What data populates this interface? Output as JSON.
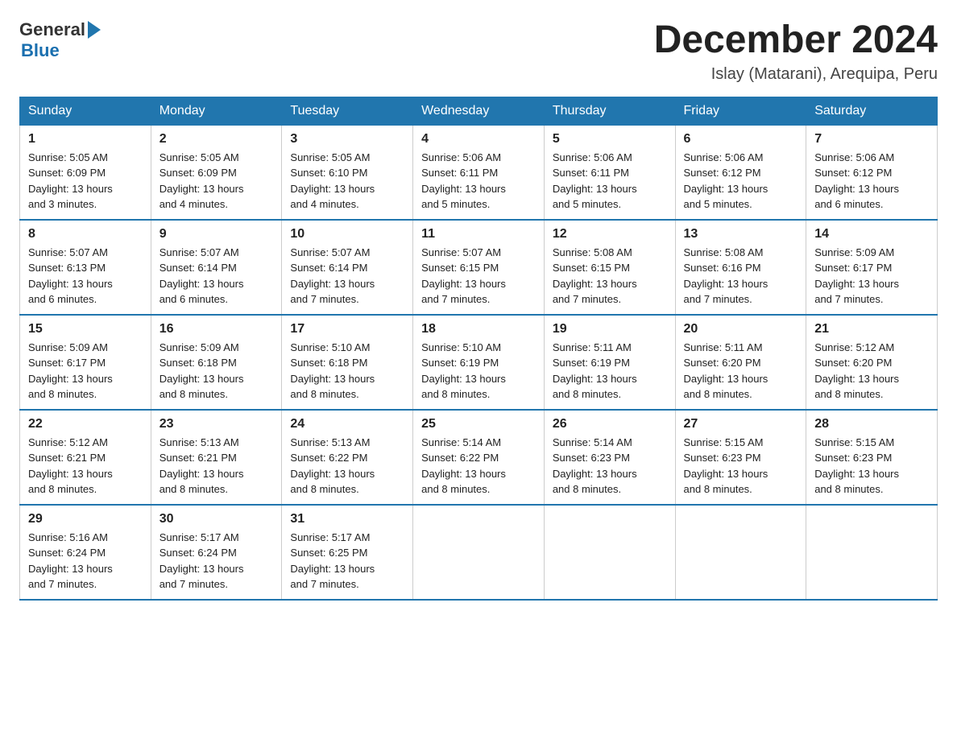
{
  "header": {
    "logo": {
      "general": "General",
      "blue": "Blue",
      "arrow": true
    },
    "title": "December 2024",
    "location": "Islay (Matarani), Arequipa, Peru"
  },
  "calendar": {
    "days_of_week": [
      "Sunday",
      "Monday",
      "Tuesday",
      "Wednesday",
      "Thursday",
      "Friday",
      "Saturday"
    ],
    "weeks": [
      [
        {
          "day": "1",
          "sunrise": "5:05 AM",
          "sunset": "6:09 PM",
          "daylight": "13 hours and 3 minutes."
        },
        {
          "day": "2",
          "sunrise": "5:05 AM",
          "sunset": "6:09 PM",
          "daylight": "13 hours and 4 minutes."
        },
        {
          "day": "3",
          "sunrise": "5:05 AM",
          "sunset": "6:10 PM",
          "daylight": "13 hours and 4 minutes."
        },
        {
          "day": "4",
          "sunrise": "5:06 AM",
          "sunset": "6:11 PM",
          "daylight": "13 hours and 5 minutes."
        },
        {
          "day": "5",
          "sunrise": "5:06 AM",
          "sunset": "6:11 PM",
          "daylight": "13 hours and 5 minutes."
        },
        {
          "day": "6",
          "sunrise": "5:06 AM",
          "sunset": "6:12 PM",
          "daylight": "13 hours and 5 minutes."
        },
        {
          "day": "7",
          "sunrise": "5:06 AM",
          "sunset": "6:12 PM",
          "daylight": "13 hours and 6 minutes."
        }
      ],
      [
        {
          "day": "8",
          "sunrise": "5:07 AM",
          "sunset": "6:13 PM",
          "daylight": "13 hours and 6 minutes."
        },
        {
          "day": "9",
          "sunrise": "5:07 AM",
          "sunset": "6:14 PM",
          "daylight": "13 hours and 6 minutes."
        },
        {
          "day": "10",
          "sunrise": "5:07 AM",
          "sunset": "6:14 PM",
          "daylight": "13 hours and 7 minutes."
        },
        {
          "day": "11",
          "sunrise": "5:07 AM",
          "sunset": "6:15 PM",
          "daylight": "13 hours and 7 minutes."
        },
        {
          "day": "12",
          "sunrise": "5:08 AM",
          "sunset": "6:15 PM",
          "daylight": "13 hours and 7 minutes."
        },
        {
          "day": "13",
          "sunrise": "5:08 AM",
          "sunset": "6:16 PM",
          "daylight": "13 hours and 7 minutes."
        },
        {
          "day": "14",
          "sunrise": "5:09 AM",
          "sunset": "6:17 PM",
          "daylight": "13 hours and 7 minutes."
        }
      ],
      [
        {
          "day": "15",
          "sunrise": "5:09 AM",
          "sunset": "6:17 PM",
          "daylight": "13 hours and 8 minutes."
        },
        {
          "day": "16",
          "sunrise": "5:09 AM",
          "sunset": "6:18 PM",
          "daylight": "13 hours and 8 minutes."
        },
        {
          "day": "17",
          "sunrise": "5:10 AM",
          "sunset": "6:18 PM",
          "daylight": "13 hours and 8 minutes."
        },
        {
          "day": "18",
          "sunrise": "5:10 AM",
          "sunset": "6:19 PM",
          "daylight": "13 hours and 8 minutes."
        },
        {
          "day": "19",
          "sunrise": "5:11 AM",
          "sunset": "6:19 PM",
          "daylight": "13 hours and 8 minutes."
        },
        {
          "day": "20",
          "sunrise": "5:11 AM",
          "sunset": "6:20 PM",
          "daylight": "13 hours and 8 minutes."
        },
        {
          "day": "21",
          "sunrise": "5:12 AM",
          "sunset": "6:20 PM",
          "daylight": "13 hours and 8 minutes."
        }
      ],
      [
        {
          "day": "22",
          "sunrise": "5:12 AM",
          "sunset": "6:21 PM",
          "daylight": "13 hours and 8 minutes."
        },
        {
          "day": "23",
          "sunrise": "5:13 AM",
          "sunset": "6:21 PM",
          "daylight": "13 hours and 8 minutes."
        },
        {
          "day": "24",
          "sunrise": "5:13 AM",
          "sunset": "6:22 PM",
          "daylight": "13 hours and 8 minutes."
        },
        {
          "day": "25",
          "sunrise": "5:14 AM",
          "sunset": "6:22 PM",
          "daylight": "13 hours and 8 minutes."
        },
        {
          "day": "26",
          "sunrise": "5:14 AM",
          "sunset": "6:23 PM",
          "daylight": "13 hours and 8 minutes."
        },
        {
          "day": "27",
          "sunrise": "5:15 AM",
          "sunset": "6:23 PM",
          "daylight": "13 hours and 8 minutes."
        },
        {
          "day": "28",
          "sunrise": "5:15 AM",
          "sunset": "6:23 PM",
          "daylight": "13 hours and 8 minutes."
        }
      ],
      [
        {
          "day": "29",
          "sunrise": "5:16 AM",
          "sunset": "6:24 PM",
          "daylight": "13 hours and 7 minutes."
        },
        {
          "day": "30",
          "sunrise": "5:17 AM",
          "sunset": "6:24 PM",
          "daylight": "13 hours and 7 minutes."
        },
        {
          "day": "31",
          "sunrise": "5:17 AM",
          "sunset": "6:25 PM",
          "daylight": "13 hours and 7 minutes."
        },
        null,
        null,
        null,
        null
      ]
    ],
    "labels": {
      "sunrise": "Sunrise:",
      "sunset": "Sunset:",
      "daylight": "Daylight:"
    }
  }
}
